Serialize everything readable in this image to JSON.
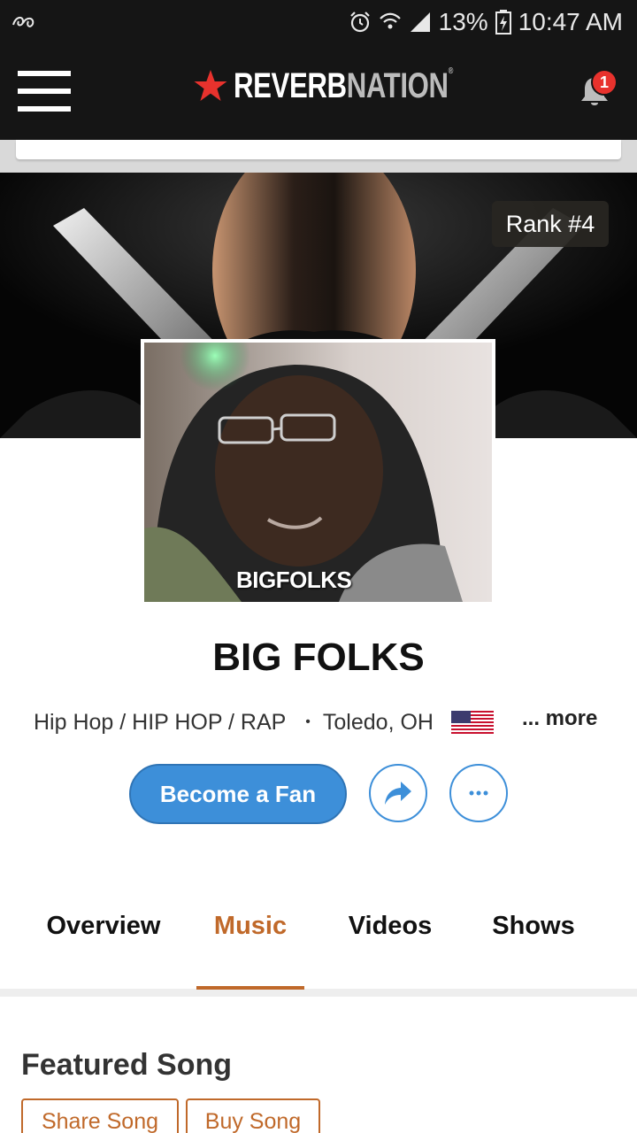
{
  "status_bar": {
    "battery": "13%",
    "time": "10:47 AM",
    "icons": [
      "notification-app-icon",
      "alarm-icon",
      "wifi-icon",
      "signal-icon",
      "battery-icon"
    ]
  },
  "header": {
    "logo_left": "REVERB",
    "logo_right": "NATION",
    "notification_count": "1",
    "icons": [
      "menu-icon",
      "star-logo-icon",
      "bell-icon"
    ]
  },
  "banner": {
    "rank": "Rank #4"
  },
  "profile": {
    "photo_caption": "BIGFOLKS",
    "artist_name": "BIG FOLKS",
    "genre": "Hip Hop / HIP HOP / RAP",
    "separator": "•",
    "location": "Toledo, OH",
    "more": "... more",
    "flag": "us-flag-icon"
  },
  "actions": {
    "fan_label": "Become a Fan",
    "icons": [
      "share-icon",
      "more-options-icon"
    ]
  },
  "tabs": [
    {
      "label": "Overview",
      "active": false
    },
    {
      "label": "Music",
      "active": true
    },
    {
      "label": "Videos",
      "active": false
    },
    {
      "label": "Shows",
      "active": false
    }
  ],
  "featured": {
    "title": "Featured Song",
    "share_label": "Share Song",
    "buy_label": "Buy Song"
  },
  "colors": {
    "header_bg": "#151515",
    "brand_red": "#e8322d",
    "accent_orange": "#c0692a",
    "button_blue": "#3d8fd9"
  }
}
